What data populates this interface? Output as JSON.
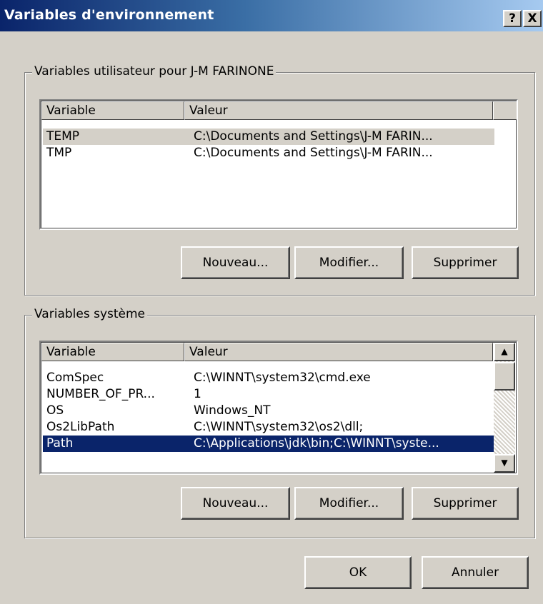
{
  "window": {
    "title": "Variables d'environnement",
    "help_label": "?",
    "close_label": "X"
  },
  "user_vars": {
    "legend": "Variables utilisateur pour J-M FARINONE",
    "columns": [
      "Variable",
      "Valeur"
    ],
    "rows": [
      {
        "name": "TEMP",
        "value": "C:\\Documents and Settings\\J-M FARIN..."
      },
      {
        "name": "TMP",
        "value": "C:\\Documents and Settings\\J-M FARIN..."
      }
    ],
    "buttons": {
      "new": "Nouveau...",
      "edit": "Modifier...",
      "delete": "Supprimer"
    }
  },
  "system_vars": {
    "legend": "Variables système",
    "columns": [
      "Variable",
      "Valeur"
    ],
    "rows": [
      {
        "name": "ComSpec",
        "value": "C:\\WINNT\\system32\\cmd.exe"
      },
      {
        "name": "NUMBER_OF_PR...",
        "value": "1"
      },
      {
        "name": "OS",
        "value": "Windows_NT"
      },
      {
        "name": "Os2LibPath",
        "value": "C:\\WINNT\\system32\\os2\\dll;"
      },
      {
        "name": "Path",
        "value": "C:\\Applications\\jdk\\bin;C:\\WINNT\\syste..."
      }
    ],
    "buttons": {
      "new": "Nouveau...",
      "edit": "Modifier...",
      "delete": "Supprimer"
    }
  },
  "footer": {
    "ok": "OK",
    "cancel": "Annuler"
  },
  "colors": {
    "face": "#d4d0c8",
    "selection": "#0a246a",
    "title_start": "#0a246a",
    "title_end": "#a6caf0"
  }
}
